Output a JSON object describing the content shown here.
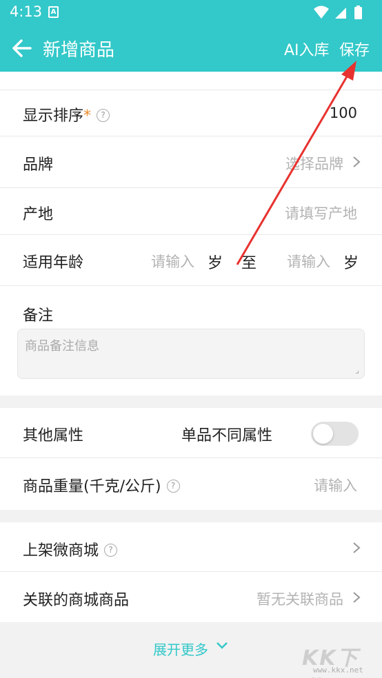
{
  "status_bar": {
    "time": "4:13",
    "notif_icon": "A"
  },
  "toolbar": {
    "title": "新增商品",
    "ai_label": "AI入库",
    "save_label": "保存"
  },
  "form": {
    "sort": {
      "label": "显示排序",
      "required_mark": "*",
      "help": "?",
      "value": "100"
    },
    "brand": {
      "label": "品牌",
      "placeholder": "选择品牌"
    },
    "origin": {
      "label": "产地",
      "placeholder": "请填写产地"
    },
    "age": {
      "label": "适用年龄",
      "from_placeholder": "请输入",
      "from_unit": "岁",
      "sep": "至",
      "to_placeholder": "请输入",
      "to_unit": "岁"
    },
    "remark": {
      "label": "备注",
      "placeholder": "商品备注信息"
    },
    "attrs": {
      "label": "其他属性",
      "toggle_label": "单品不同属性",
      "toggle_on": false
    },
    "weight": {
      "label": "商品重量(千克/公斤)",
      "help": "?",
      "placeholder": "请输入"
    },
    "mall": {
      "label": "上架微商城",
      "help": "?"
    },
    "linked": {
      "label": "关联的商城商品",
      "value": "暂无关联商品"
    }
  },
  "expand": {
    "label": "展开更多"
  },
  "watermark": {
    "text": "KK下载",
    "url": "www.kkx.net"
  },
  "colors": {
    "accent": "#33c8c9",
    "required": "#f08a2c",
    "annotation": "#e8322f"
  }
}
